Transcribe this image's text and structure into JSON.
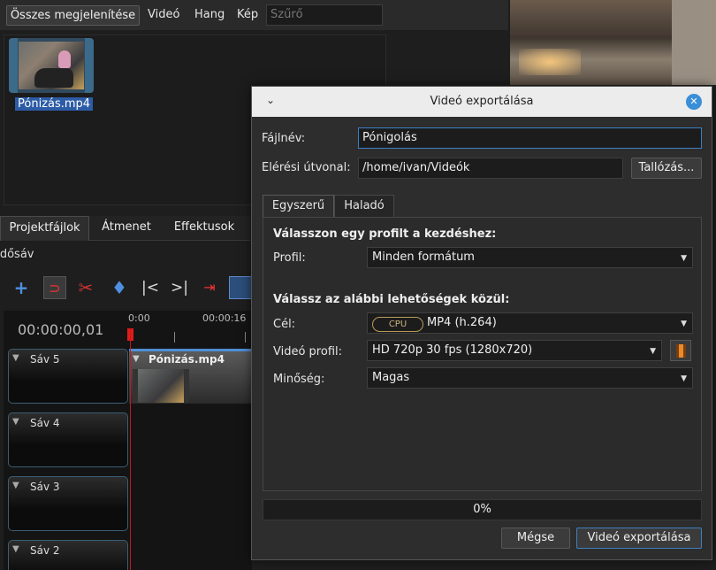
{
  "filters": {
    "show_all": "Összes megjelenítése",
    "video": "Videó",
    "audio": "Hang",
    "image": "Kép",
    "search_placeholder": "Szűrő"
  },
  "project_files": {
    "items": [
      {
        "label": "Pónizás.mp4"
      }
    ]
  },
  "bottom_tabs": [
    "Projektfájlok",
    "Átmenet",
    "Effektusok"
  ],
  "timeline": {
    "label": "Idősáv",
    "timecode": "00:00:00,01",
    "ruler": [
      "0:00",
      "00:00:16"
    ],
    "toolbar_icons": [
      "add-track-icon",
      "magnet-icon",
      "razor-icon",
      "add-marker-icon",
      "jump-start-icon",
      "jump-end-icon",
      "center-playhead-icon"
    ],
    "tracks": [
      {
        "name": "Sáv 5",
        "clip": "Pónizás.mp4"
      },
      {
        "name": "Sáv 4",
        "clip": ""
      },
      {
        "name": "Sáv 3",
        "clip": ""
      },
      {
        "name": "Sáv 2",
        "clip": ""
      }
    ]
  },
  "dialog": {
    "title": "Videó exportálása",
    "filename_label": "Fájlnév:",
    "filename_value": "Pónigolás",
    "path_label": "Elérési útvonal:",
    "path_value": "/home/ivan/Videók",
    "browse_button": "Tallózás...",
    "tabs": [
      "Egyszerű",
      "Haladó"
    ],
    "active_tab": "Egyszerű",
    "section_profile": "Válasszon egy profilt a kezdéshez:",
    "profile_label": "Profil:",
    "profile_value": "Minden formátum",
    "section_options": "Válassz az alábbi lehetőségek közül:",
    "target_label": "Cél:",
    "target_badge": "CPU",
    "target_value": "MP4 (h.264)",
    "video_profile_label": "Videó profil:",
    "video_profile_value": "HD 720p 30 fps (1280x720)",
    "quality_label": "Minőség:",
    "quality_value": "Magas",
    "progress_text": "0%",
    "progress_value": 0,
    "cancel_button": "Mégse",
    "export_button": "Videó exportálása",
    "accent_color": "#3b8ed8"
  }
}
